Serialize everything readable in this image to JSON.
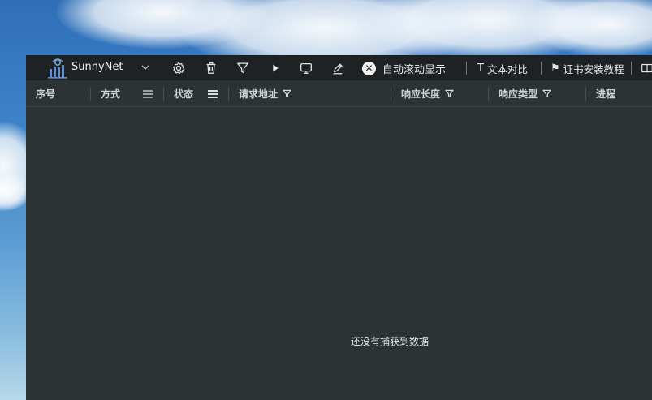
{
  "app": {
    "name": "SunnyNet",
    "colors": {
      "toolbar": "#1e2224",
      "content": "#2b3335",
      "text": "#e6e6e6"
    }
  },
  "toolbar": {
    "icons": [
      "gear-icon",
      "trash-icon",
      "filter-icon",
      "play-icon",
      "monitor-icon",
      "pen-icon"
    ],
    "auto_scroll_label": "自动滚动显示",
    "text_compare_label": "文本对比",
    "cert_install_label": "证书安装教程"
  },
  "columns": [
    {
      "label": "序号"
    },
    {
      "label": "方式",
      "icon": "menu-icon"
    },
    {
      "label": "状态",
      "icon": "menu-icon"
    },
    {
      "label": "请求地址",
      "icon": "filter-icon"
    },
    {
      "label": "响应长度",
      "icon": "filter-icon"
    },
    {
      "label": "响应类型",
      "icon": "filter-icon"
    },
    {
      "label": "进程"
    }
  ],
  "empty_state": "还没有捕获到数据"
}
